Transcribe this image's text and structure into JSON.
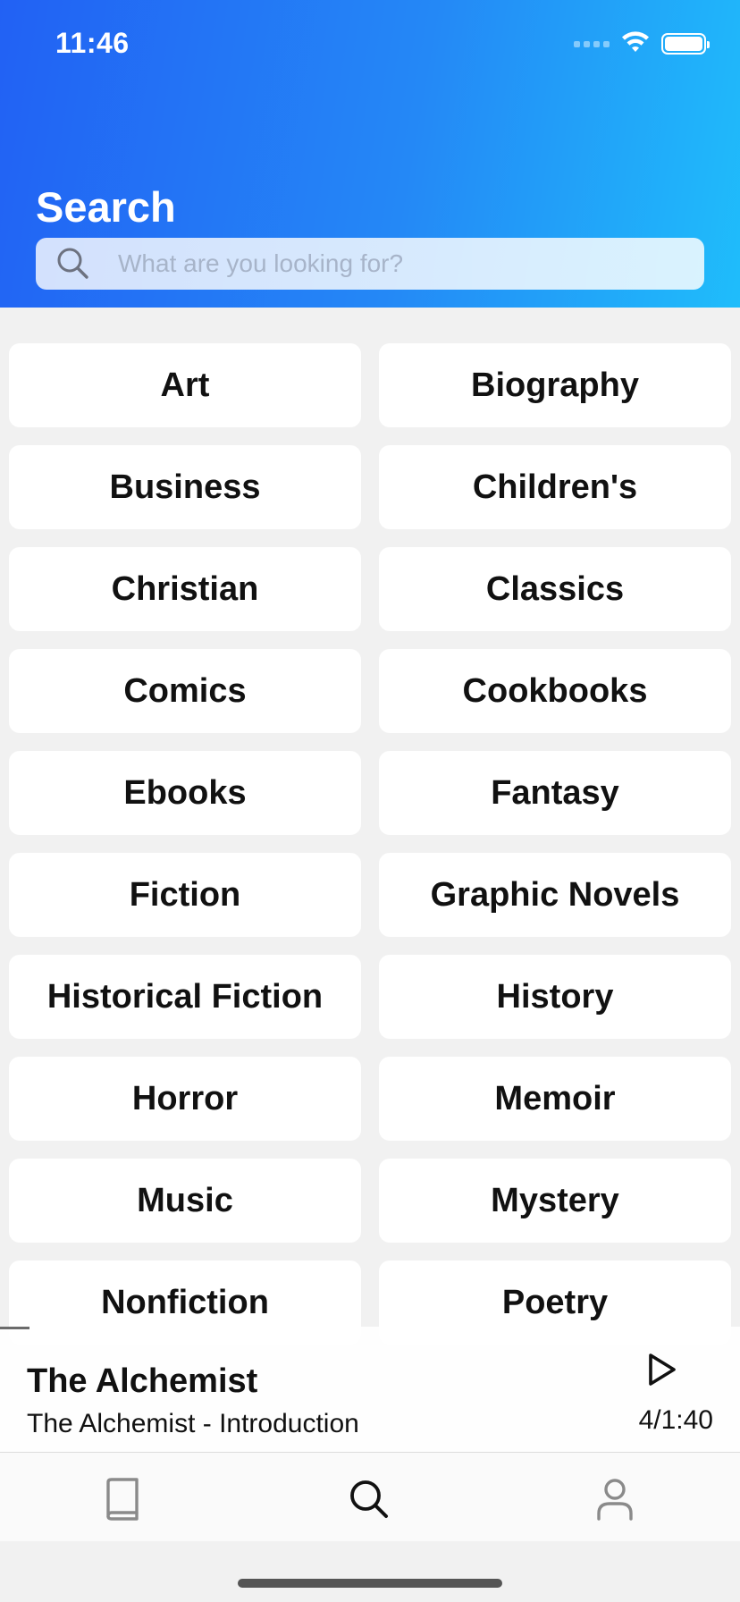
{
  "status_bar": {
    "time": "11:46"
  },
  "header": {
    "title": "Search",
    "search": {
      "placeholder": "What are you looking for?",
      "value": ""
    }
  },
  "categories": [
    "Art",
    "Biography",
    "Business",
    "Children's",
    "Christian",
    "Classics",
    "Comics",
    "Cookbooks",
    "Ebooks",
    "Fantasy",
    "Fiction",
    "Graphic Novels",
    "Historical Fiction",
    "History",
    "Horror",
    "Memoir",
    "Music",
    "Mystery",
    "Nonfiction",
    "Poetry"
  ],
  "player": {
    "title": "The Alchemist",
    "subtitle": "The Alchemist - Introduction",
    "time": "4/1:40",
    "progress": 0.04
  },
  "tabbar": {
    "items": [
      {
        "icon": "book-icon",
        "active": false
      },
      {
        "icon": "search-icon",
        "active": true
      },
      {
        "icon": "person-icon",
        "active": false
      }
    ]
  },
  "colors": {
    "header_gradient_start": "#2261f4",
    "header_gradient_end": "#1fbdfb",
    "tab_active": "#111111",
    "tab_inactive": "#8a8a8a"
  }
}
